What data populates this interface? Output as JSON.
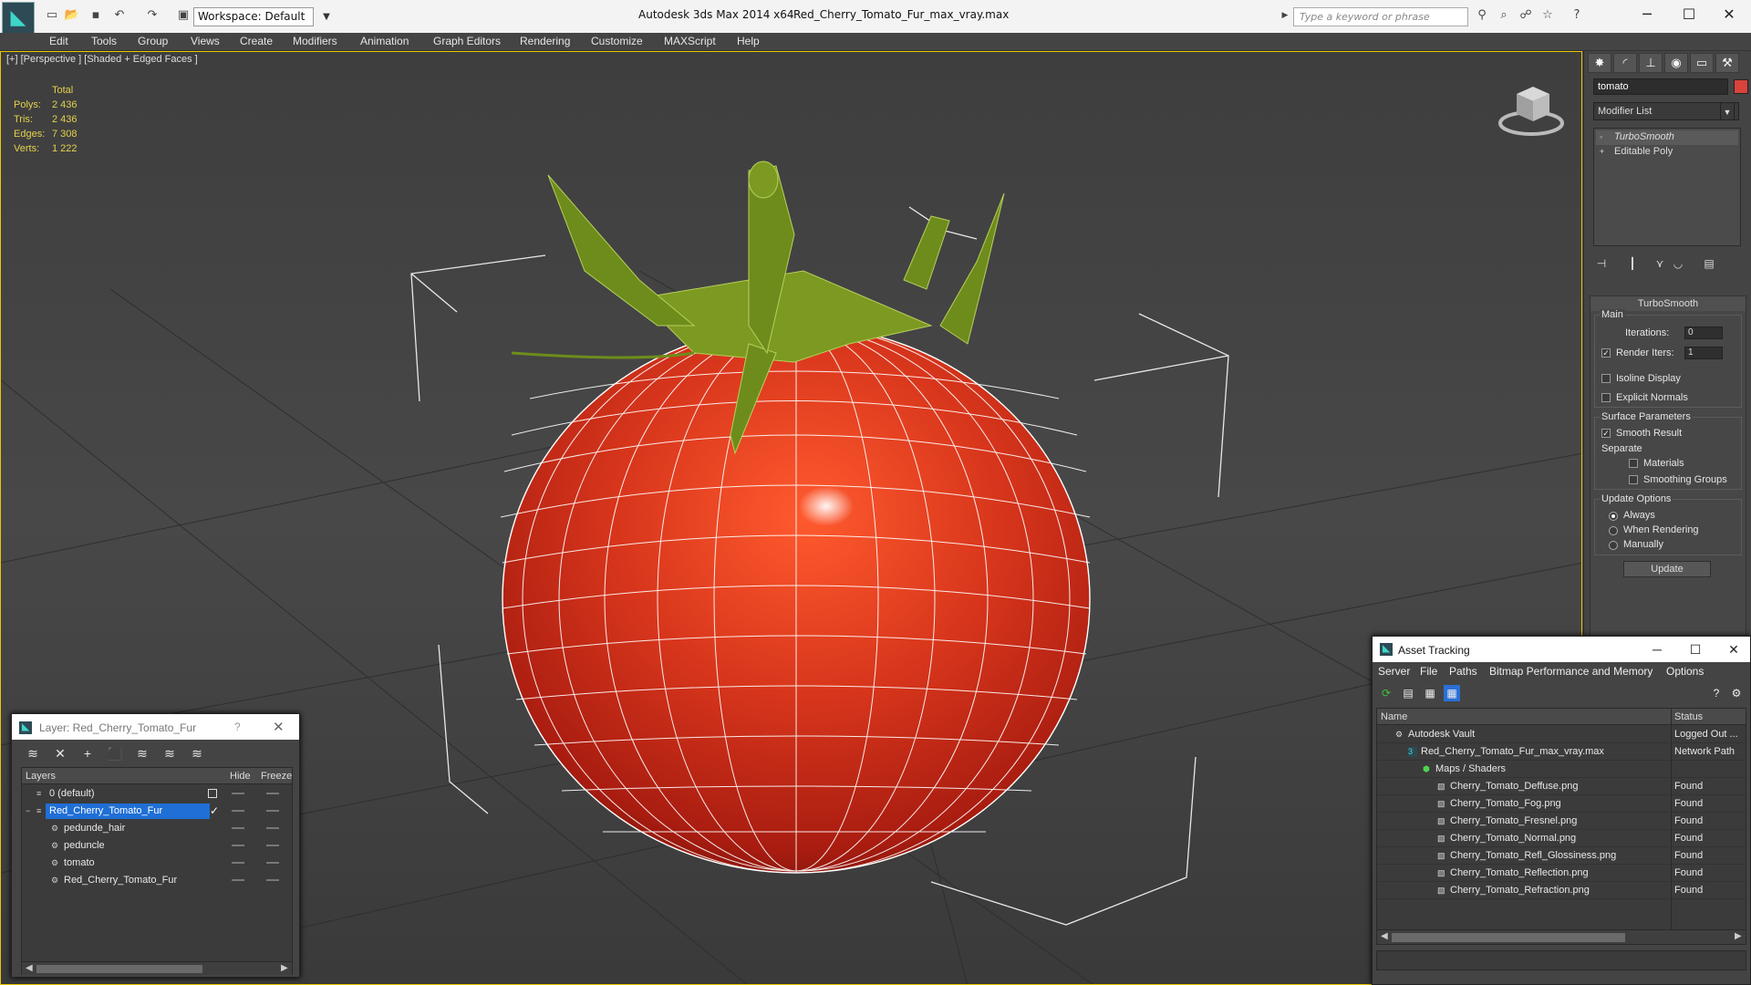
{
  "titlebar": {
    "workspace": "Workspace: Default",
    "app_title": "Autodesk 3ds Max  2014 x64",
    "file_title": "Red_Cherry_Tomato_Fur_max_vray.max",
    "search_placeholder": "Type a keyword or phrase"
  },
  "menu": [
    "Edit",
    "Tools",
    "Group",
    "Views",
    "Create",
    "Modifiers",
    "Animation",
    "Graph Editors",
    "Rendering",
    "Customize",
    "MAXScript",
    "Help"
  ],
  "viewport": {
    "label": "[+] [Perspective ] [Shaded + Edged Faces ]",
    "stats": {
      "header": "Total",
      "rows": [
        {
          "k": "Polys:",
          "v": "2 436"
        },
        {
          "k": "Tris:",
          "v": "2 436"
        },
        {
          "k": "Edges:",
          "v": "7 308"
        },
        {
          "k": "Verts:",
          "v": "1 222"
        }
      ]
    },
    "colors": {
      "tomato": "#d8361c",
      "stem": "#7c9a22",
      "wire": "#ffffff",
      "stats": "#e3d24c"
    }
  },
  "command_panel": {
    "object_name": "tomato",
    "object_color": "#d9433b",
    "modifier_list": "Modifier List",
    "stack": [
      "TurboSmooth",
      "Editable Poly"
    ],
    "turbosmooth": {
      "title": "TurboSmooth",
      "main": "Main",
      "iterations_label": "Iterations:",
      "iterations": "0",
      "render_iters_label": "Render Iters:",
      "render_iters": "1",
      "isoline": "Isoline Display",
      "explicit_normals": "Explicit Normals",
      "surface_params": "Surface Parameters",
      "smooth_result": "Smooth Result",
      "separate": "Separate",
      "materials": "Materials",
      "smoothing_groups": "Smoothing Groups",
      "update_options": "Update Options",
      "always": "Always",
      "when_rendering": "When Rendering",
      "manually": "Manually",
      "update": "Update"
    }
  },
  "layer_window": {
    "title": "Layer: Red_Cherry_Tomato_Fur",
    "help": "?",
    "columns": [
      "Layers",
      "Hide",
      "Freeze"
    ],
    "rows": [
      {
        "name": "0 (default)"
      },
      {
        "name": "Red_Cherry_Tomato_Fur"
      },
      {
        "name": "pedunde_hair"
      },
      {
        "name": "peduncle"
      },
      {
        "name": "tomato"
      },
      {
        "name": "Red_Cherry_Tomato_Fur"
      }
    ]
  },
  "asset_tracking": {
    "title": "Asset Tracking",
    "menu": [
      "Server",
      "File",
      "Paths",
      "Bitmap Performance and Memory",
      "Options"
    ],
    "columns": [
      "Name",
      "Status"
    ],
    "rows": [
      {
        "name": "Autodesk Vault",
        "status": "Logged Out ..."
      },
      {
        "name": "Red_Cherry_Tomato_Fur_max_vray.max",
        "status": "Network Path"
      },
      {
        "name": "Maps / Shaders",
        "status": ""
      },
      {
        "name": "Cherry_Tomato_Deffuse.png",
        "status": "Found"
      },
      {
        "name": "Cherry_Tomato_Fog.png",
        "status": "Found"
      },
      {
        "name": "Cherry_Tomato_Fresnel.png",
        "status": "Found"
      },
      {
        "name": "Cherry_Tomato_Normal.png",
        "status": "Found"
      },
      {
        "name": "Cherry_Tomato_Refl_Glossiness.png",
        "status": "Found"
      },
      {
        "name": "Cherry_Tomato_Reflection.png",
        "status": "Found"
      },
      {
        "name": "Cherry_Tomato_Refraction.png",
        "status": "Found"
      }
    ]
  }
}
